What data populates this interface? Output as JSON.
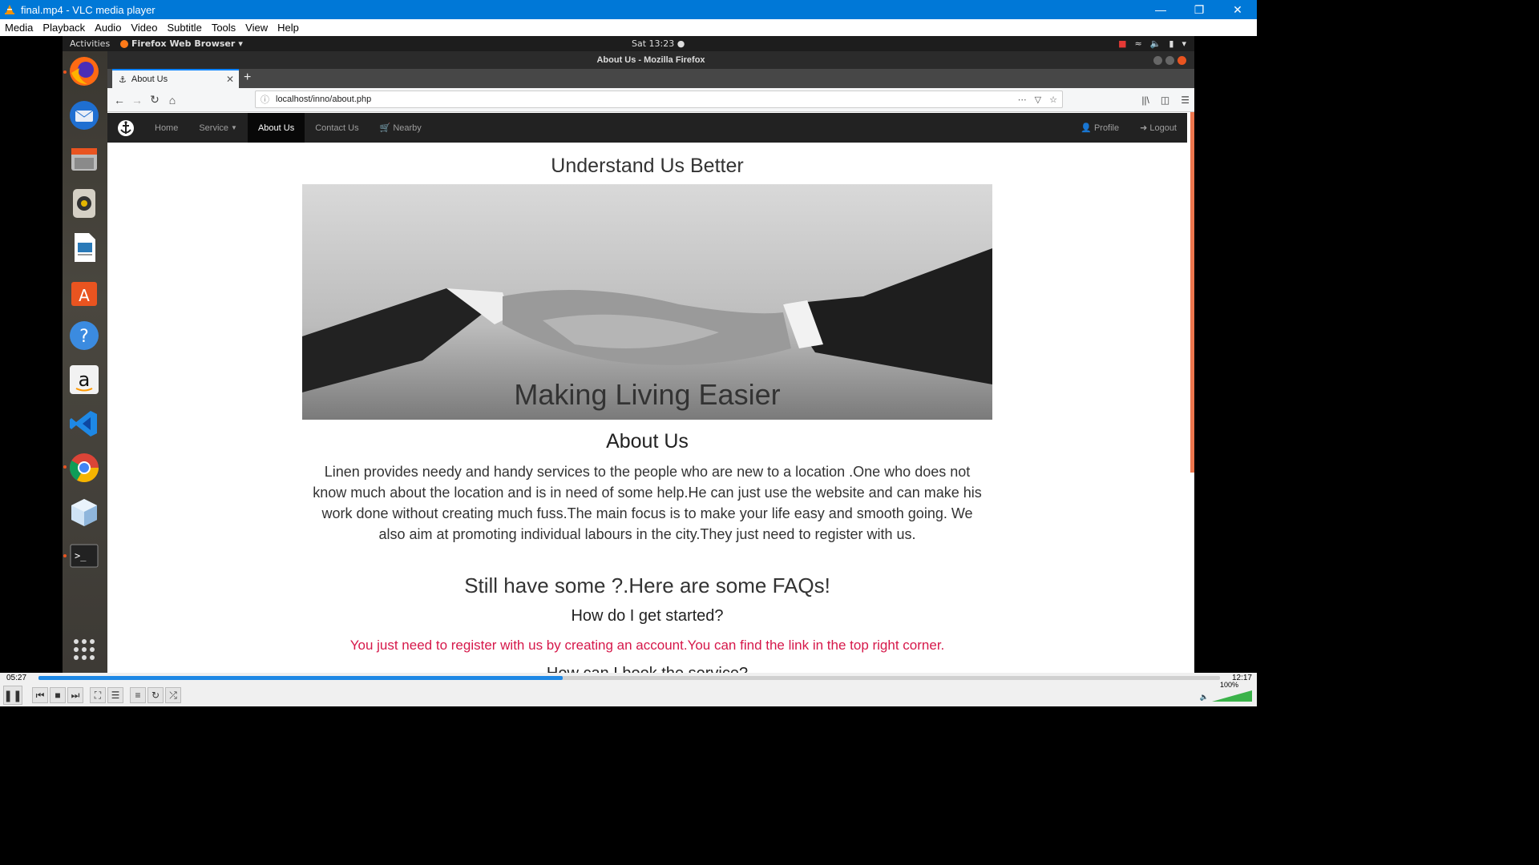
{
  "vlc": {
    "title": "final.mp4 - VLC media player",
    "menu": [
      "Media",
      "Playback",
      "Audio",
      "Video",
      "Subtitle",
      "Tools",
      "View",
      "Help"
    ],
    "time_elapsed": "05:27",
    "time_total": "12:17",
    "progress": 0.444,
    "volume": "100%"
  },
  "ubuntu": {
    "activities": "Activities",
    "app_menu": "Firefox Web Browser",
    "clock": "Sat 13:23",
    "dock_icons": [
      "firefox-icon",
      "thunderbird-icon",
      "files-icon",
      "rhythmbox-icon",
      "libreoffice-writer-icon",
      "software-center-icon",
      "help-icon",
      "amazon-icon",
      "vscode-icon",
      "chrome-icon",
      "box-icon",
      "terminal-icon",
      "app-grid-icon"
    ]
  },
  "firefox": {
    "window_title": "About Us - Mozilla Firefox",
    "tab_title": "About Us",
    "url": "localhost/inno/about.php"
  },
  "site": {
    "nav": {
      "home": "Home",
      "service": "Service",
      "about": "About Us",
      "contact": "Contact Us",
      "nearby": "Nearby",
      "profile": "Profile",
      "logout": "Logout"
    },
    "heading": "Understand Us Better",
    "hero_caption": "Making Living Easier",
    "about_title": "About Us",
    "about_text": "Linen provides needy and handy services to the people who are new to a location .One who does not know much about the location and is in need of some help.He can just use the website and can make his work done without creating much fuss.The main focus is to make your life easy and smooth going. We also aim at promoting individual labours in the city.They just need to register with us.",
    "faq_title": "Still have some ?.Here are some FAQs!",
    "q1": "How do I get started?",
    "a1": "You just need to register with us by creating an account.You can find the link in the top right corner.",
    "q2": "How can I book the service?"
  }
}
